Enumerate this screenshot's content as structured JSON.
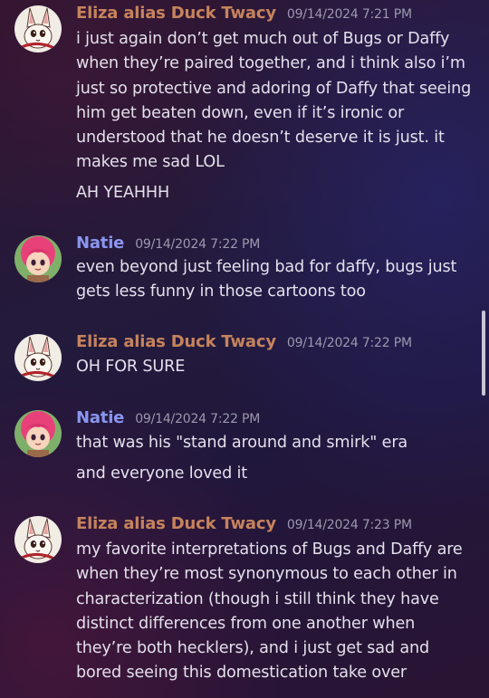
{
  "messages": [
    {
      "author": "Eliza alias Duck Twacy",
      "timestamp": "09/14/2024 7:21 PM",
      "lines": [
        "i just again don’t get much out of Bugs or Daffy when they’re paired together, and i think also i’m just so protective and adoring of Daffy that seeing him get beaten down, even if it’s ironic or understood that he doesn’t deserve it is just. it makes me sad LOL",
        "AH YEAHHH"
      ]
    },
    {
      "author": "Natie",
      "timestamp": "09/14/2024 7:22 PM",
      "lines": [
        "even beyond just feeling bad for daffy, bugs just gets less funny in those cartoons too"
      ]
    },
    {
      "author": "Eliza alias Duck Twacy",
      "timestamp": "09/14/2024 7:22 PM",
      "lines": [
        "OH FOR SURE"
      ]
    },
    {
      "author": "Natie",
      "timestamp": "09/14/2024 7:22 PM",
      "lines": [
        "that was his \"stand around and smirk\" era",
        "and everyone loved it"
      ]
    },
    {
      "author": "Eliza alias Duck Twacy",
      "timestamp": "09/14/2024 7:23 PM",
      "lines": [
        "my favorite interpretations of Bugs and Daffy are when they’re most synonymous to each other in characterization (though i still think they have distinct differences from one another when they’re both hecklers), and i just get sad and bored seeing this domestication take over"
      ]
    }
  ],
  "colors": {
    "eliza_name": "#c6835d",
    "natie_name": "#8a96ef",
    "timestamp": "#9c98ad",
    "message_text": "#e4e0ec"
  },
  "icons": {
    "eliza_avatar": "rabbit-avatar-icon",
    "natie_avatar": "pink-haired-character-avatar-icon"
  }
}
